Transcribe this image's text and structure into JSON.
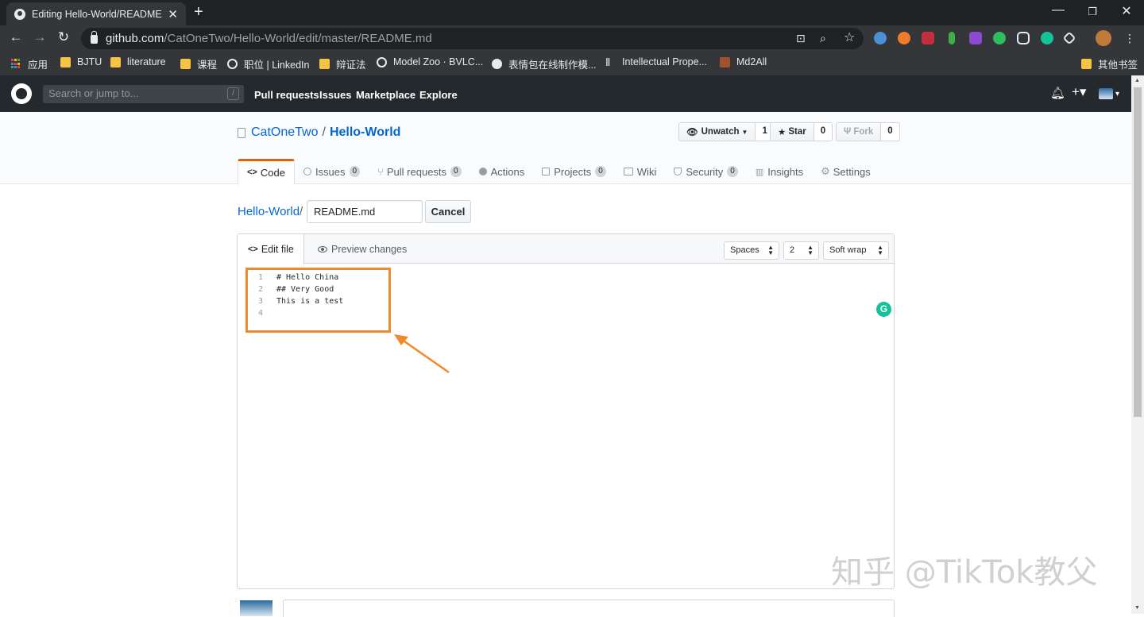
{
  "browser": {
    "tab_title": "Editing Hello-World/README.",
    "url_host": "github.com",
    "url_path": "/CatOneTwo/Hello-World/edit/master/README.md",
    "bookmarks": [
      {
        "label": "应用",
        "icon": "apps-grid-icon"
      },
      {
        "label": "BJTU",
        "icon": "folder-icon"
      },
      {
        "label": "literature",
        "icon": "folder-icon"
      },
      {
        "label": "课程",
        "icon": "folder-icon"
      },
      {
        "label": "职位 | LinkedIn",
        "icon": "globe-icon"
      },
      {
        "label": "辩证法",
        "icon": "folder-icon"
      },
      {
        "label": "Model Zoo · BVLC...",
        "icon": "globe-icon"
      },
      {
        "label": "表情包在线制作模...",
        "icon": "emoji-icon"
      },
      {
        "label": "Intellectual Prope...",
        "icon": "pen-icon"
      },
      {
        "label": "Md2All",
        "icon": "image-icon"
      },
      {
        "label": "其他书签",
        "icon": "folder-icon"
      }
    ]
  },
  "github": {
    "search_placeholder": "Search or jump to...",
    "search_shortcut": "/",
    "nav": [
      "Pull requests",
      "Issues",
      "Marketplace",
      "Explore"
    ],
    "owner": "CatOneTwo",
    "separator": "/",
    "repo": "Hello-World",
    "watch": {
      "label": "Unwatch",
      "count": "1"
    },
    "star": {
      "label": "Star",
      "count": "0"
    },
    "fork": {
      "label": "Fork",
      "count": "0"
    },
    "tabs": [
      {
        "label": "Code",
        "count": ""
      },
      {
        "label": "Issues",
        "count": "0"
      },
      {
        "label": "Pull requests",
        "count": "0"
      },
      {
        "label": "Actions",
        "count": ""
      },
      {
        "label": "Projects",
        "count": "0"
      },
      {
        "label": "Wiki",
        "count": ""
      },
      {
        "label": "Security",
        "count": "0"
      },
      {
        "label": "Insights",
        "count": ""
      },
      {
        "label": "Settings",
        "count": ""
      }
    ]
  },
  "edit": {
    "breadcrumb_repo": "Hello-World",
    "breadcrumb_sep": "/",
    "filename": "README.md",
    "cancel_label": "Cancel",
    "tab_edit": "Edit file",
    "tab_preview": "Preview changes",
    "indent_mode": "Spaces",
    "indent_size": "2",
    "wrap_mode": "Soft wrap",
    "lines": [
      {
        "num": "1",
        "text": "# Hello China"
      },
      {
        "num": "2",
        "text": "## Very Good"
      },
      {
        "num": "3",
        "text": "This is a test"
      },
      {
        "num": "4",
        "text": ""
      }
    ]
  },
  "watermark": "知乎 @TikTok教父",
  "colors": {
    "highlight": "#f08a2c",
    "accent_tab": "#e36209",
    "link": "#0366d6"
  }
}
